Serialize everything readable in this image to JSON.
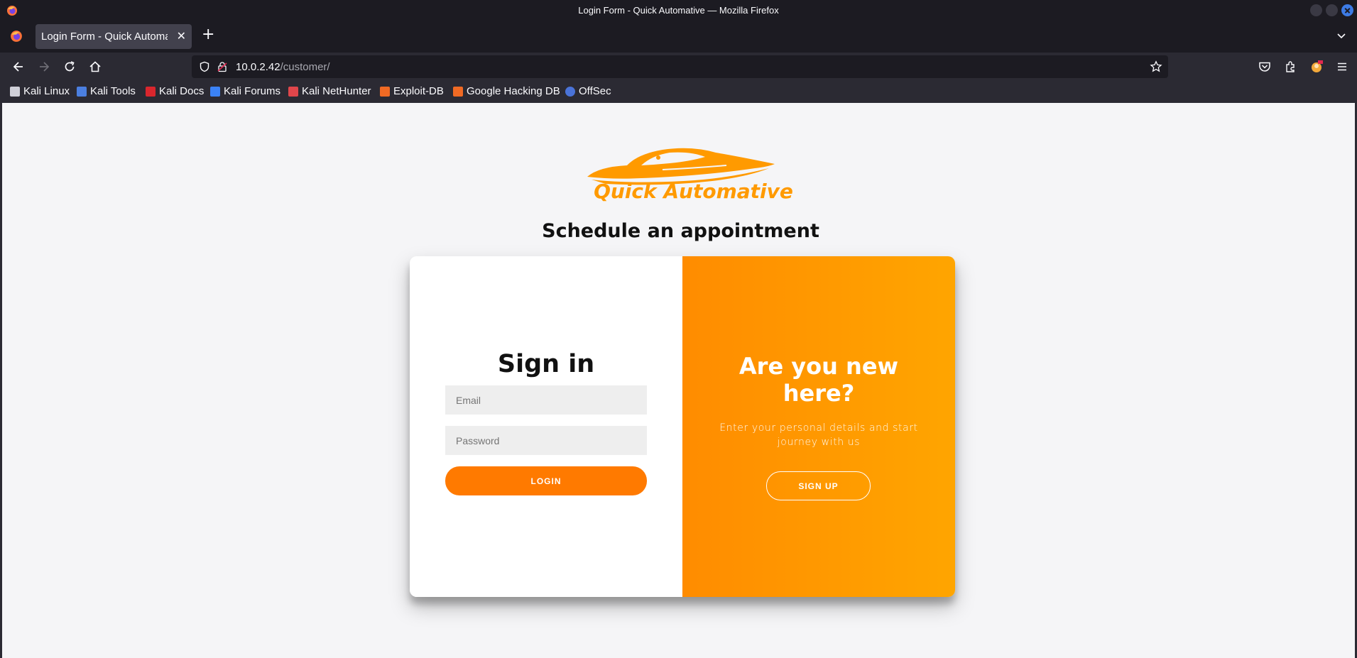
{
  "window": {
    "title": "Login Form - Quick Automative — Mozilla Firefox"
  },
  "tabs": [
    {
      "label": "Login Form - Quick Automative"
    }
  ],
  "navbar": {
    "url_host": "10.0.2.42",
    "url_path": "/customer/"
  },
  "bookmarks": [
    {
      "label": "Kali Linux",
      "icon": "kali-dragon-icon",
      "color": "#cfcfd8"
    },
    {
      "label": "Kali Tools",
      "icon": "kali-tools-icon",
      "color": "#4b7fe0"
    },
    {
      "label": "Kali Docs",
      "icon": "kali-docs-icon",
      "color": "#d9262d"
    },
    {
      "label": "Kali Forums",
      "icon": "kali-forums-icon",
      "color": "#3b82f6"
    },
    {
      "label": "Kali NetHunter",
      "icon": "kali-nethunter-icon",
      "color": "#e0464b"
    },
    {
      "label": "Exploit-DB",
      "icon": "exploit-db-icon",
      "color": "#f06a24"
    },
    {
      "label": "Google Hacking DB",
      "icon": "ghdb-icon",
      "color": "#f06a24"
    },
    {
      "label": "OffSec",
      "icon": "offsec-icon",
      "color": "#4a73d8"
    }
  ],
  "page": {
    "logo_text": "Quick Automative",
    "headline": "Schedule an appointment",
    "signin": {
      "title": "Sign in",
      "email_placeholder": "Email",
      "password_placeholder": "Password",
      "login_label": "LOGIN"
    },
    "overlay": {
      "title": "Are you new here?",
      "text": "Enter your personal details and start journey with us",
      "signup_label": "SIGN UP"
    }
  },
  "colors": {
    "brand_orange": "#ff9a00",
    "login_button": "#ff7a00",
    "overlay_gradient_start": "#ff8c00",
    "overlay_gradient_end": "#ffa500"
  }
}
